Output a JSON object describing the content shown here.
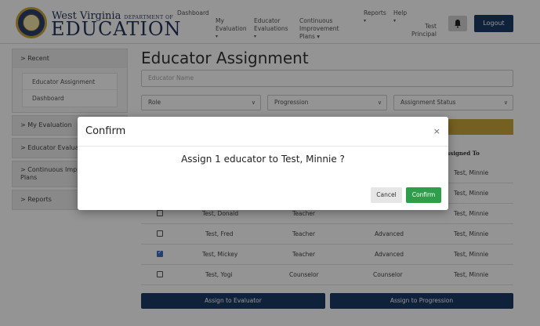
{
  "header": {
    "logo_line1": "West Virginia",
    "logo_dept": "DEPARTMENT OF",
    "logo_line2": "EDUCATION",
    "nav": [
      {
        "label": "Dashboard",
        "caret": ""
      },
      {
        "label": "My\nEvaluation",
        "caret": "▾"
      },
      {
        "label": "Educator\nEvaluations",
        "caret": "▾"
      },
      {
        "label": "Continuous\nImprovement\nPlans ▾",
        "caret": ""
      },
      {
        "label": "Reports",
        "caret": "▾"
      },
      {
        "label": "Help",
        "caret": "▾"
      },
      {
        "label": "Test\nPrincipal",
        "caret": ""
      }
    ],
    "bell_icon": "bell-icon",
    "logout_label": "Logout"
  },
  "sidebar": {
    "recent_label": "> Recent",
    "recent_links": [
      "Educator Assignment",
      "Dashboard"
    ],
    "sections": [
      "> My Evaluation",
      "> Educator Evaluations",
      "> Continuous Improvement\nPlans",
      "> Reports"
    ]
  },
  "main": {
    "title": "Educator Assignment",
    "name_placeholder": "Educator Name",
    "filters": [
      {
        "label": "Role"
      },
      {
        "label": "Progression"
      },
      {
        "label": "Assignment Status"
      }
    ],
    "assigned_to_header": "Assigned To",
    "rows": [
      {
        "checked": false,
        "name": "Test, Donald",
        "role": "Teacher",
        "progression": "",
        "assigned": "Test, Minnie"
      },
      {
        "checked": false,
        "name": "Test, Fred",
        "role": "Teacher",
        "progression": "Advanced",
        "assigned": "Test, Minnie"
      },
      {
        "checked": true,
        "name": "Test, Mickey",
        "role": "Teacher",
        "progression": "Advanced",
        "assigned": "Test, Minnie"
      },
      {
        "checked": false,
        "name": "Test, Yogi",
        "role": "Counselor",
        "progression": "Counselor",
        "assigned": "Test, Minnie"
      }
    ],
    "hidden_assigned": [
      "Test, Minnie",
      "Test, Minnie"
    ],
    "assign_evaluator_label": "Assign to Evaluator",
    "assign_progression_label": "Assign to Progression"
  },
  "modal": {
    "title": "Confirm",
    "close_glyph": "×",
    "message": "Assign 1 educator to Test, Minnie ?",
    "cancel_label": "Cancel",
    "confirm_label": "Confirm"
  },
  "colors": {
    "navy": "#1c3a66",
    "gold": "#c9a53a",
    "confirm_green": "#2f9e4b"
  }
}
